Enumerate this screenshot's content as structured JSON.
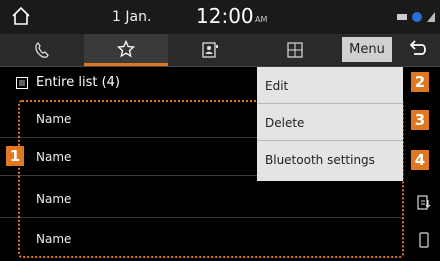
{
  "status": {
    "date": "1 Jan.",
    "time": "12:00",
    "ampm": "AM"
  },
  "tabs": [
    {
      "icon": "call-history-icon"
    },
    {
      "icon": "favorites-star-icon",
      "active": true
    },
    {
      "icon": "contacts-icon"
    },
    {
      "icon": "keypad-icon"
    }
  ],
  "menu_label": "Menu",
  "list": {
    "header": "Entire list (4)",
    "rows": [
      "Name",
      "Name",
      "Name",
      "Name"
    ]
  },
  "popup_items": [
    "Edit",
    "Delete",
    "Bluetooth settings"
  ],
  "callouts": [
    "1",
    "2",
    "3",
    "4"
  ],
  "colors": {
    "accent": "#e07820",
    "popup_bg": "#e4e4e4",
    "background": "#000000"
  }
}
